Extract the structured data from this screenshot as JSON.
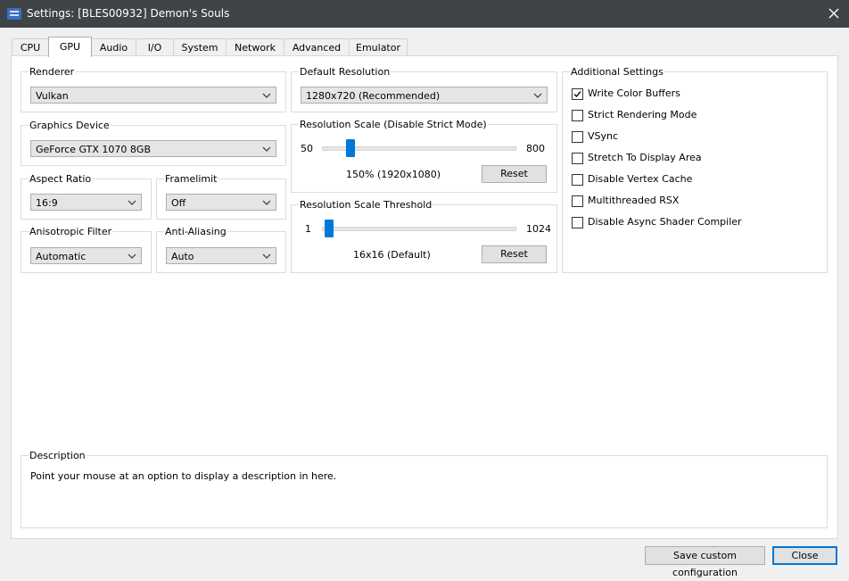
{
  "window": {
    "title": "Settings: [BLES00932] Demon's Souls",
    "app_icon": "rpcs3-icon",
    "close_icon": "close-icon"
  },
  "tabs": [
    {
      "label": "CPU",
      "active": false
    },
    {
      "label": "GPU",
      "active": true
    },
    {
      "label": "Audio",
      "active": false
    },
    {
      "label": "I/O",
      "active": false
    },
    {
      "label": "System",
      "active": false
    },
    {
      "label": "Network",
      "active": false
    },
    {
      "label": "Advanced",
      "active": false
    },
    {
      "label": "Emulator",
      "active": false
    }
  ],
  "renderer": {
    "title": "Renderer",
    "value": "Vulkan"
  },
  "graphics_device": {
    "title": "Graphics Device",
    "value": "GeForce GTX 1070 8GB"
  },
  "aspect_ratio": {
    "title": "Aspect Ratio",
    "value": "16:9"
  },
  "framelimit": {
    "title": "Framelimit",
    "value": "Off"
  },
  "anisotropic_filter": {
    "title": "Anisotropic Filter",
    "value": "Automatic"
  },
  "anti_aliasing": {
    "title": "Anti-Aliasing",
    "value": "Auto"
  },
  "default_resolution": {
    "title": "Default Resolution",
    "value": "1280x720 (Recommended)"
  },
  "resolution_scale": {
    "title": "Resolution Scale (Disable Strict Mode)",
    "min": "50",
    "max": "800",
    "value": 150,
    "value_label": "150% (1920x1080)",
    "reset": "Reset"
  },
  "resolution_scale_threshold": {
    "title": "Resolution Scale Threshold",
    "min": "1",
    "max": "1024",
    "value": 16,
    "value_label": "16x16 (Default)",
    "reset": "Reset"
  },
  "additional_settings": {
    "title": "Additional Settings",
    "items": [
      {
        "label": "Write Color Buffers",
        "checked": true
      },
      {
        "label": "Strict Rendering Mode",
        "checked": false
      },
      {
        "label": "VSync",
        "checked": false
      },
      {
        "label": "Stretch To Display Area",
        "checked": false
      },
      {
        "label": "Disable Vertex Cache",
        "checked": false
      },
      {
        "label": "Multithreaded RSX",
        "checked": false
      },
      {
        "label": "Disable Async Shader Compiler",
        "checked": false
      }
    ]
  },
  "description": {
    "title": "Description",
    "text": "Point your mouse at an option to display a description in here."
  },
  "footer": {
    "save_label": "Save custom configuration",
    "close_label": "Close"
  },
  "colors": {
    "titlebar": "#3f4447",
    "accent": "#0078d7"
  }
}
